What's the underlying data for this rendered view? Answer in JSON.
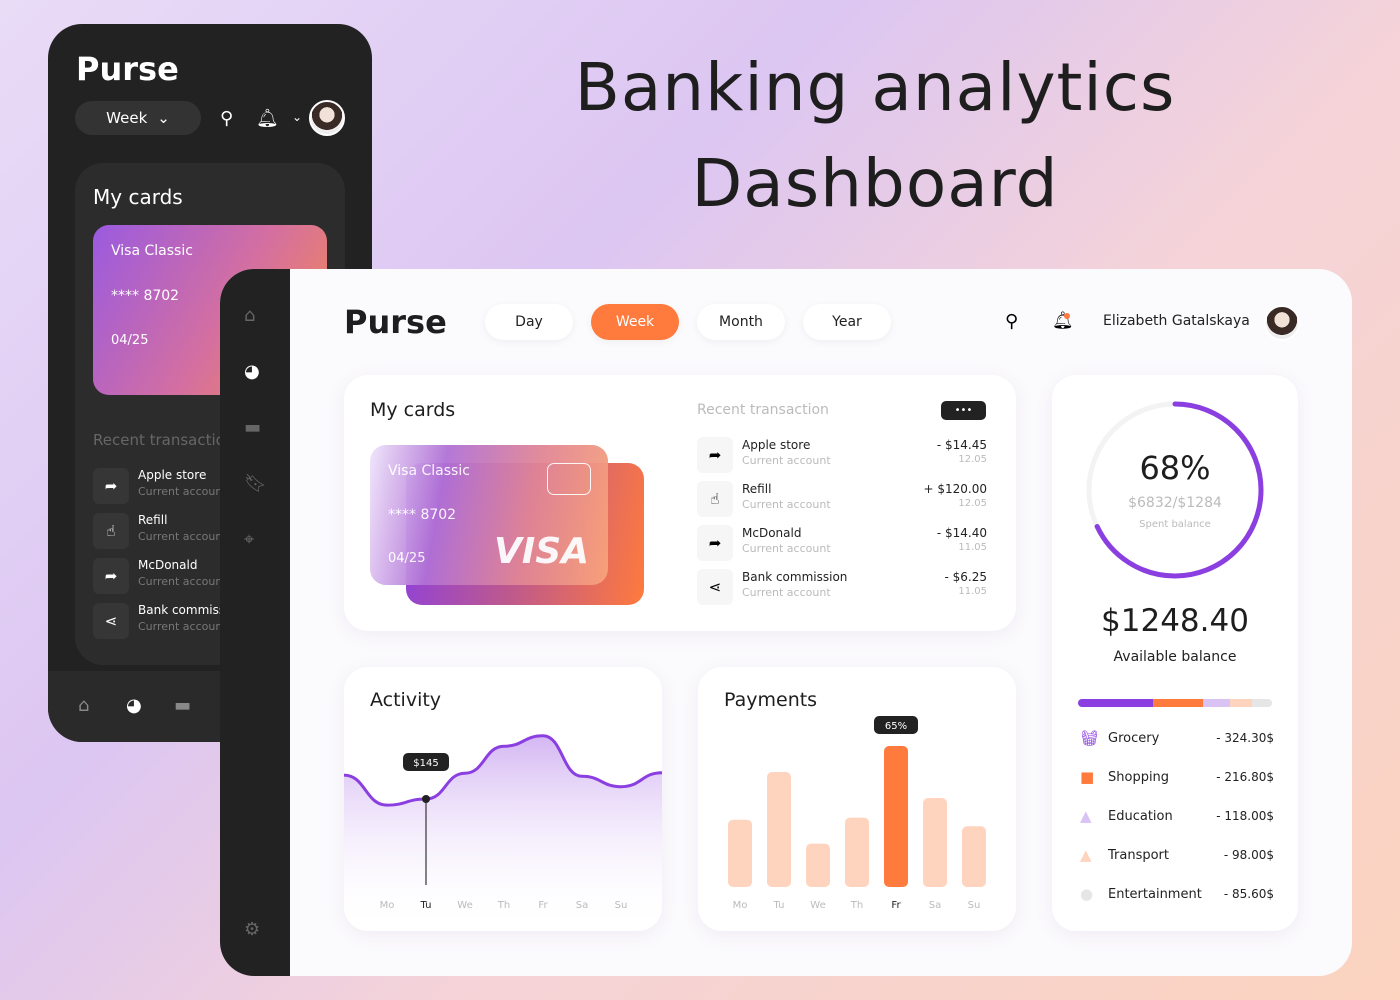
{
  "headline": [
    "Banking analytics",
    "Dashboard"
  ],
  "app_name": "Purse",
  "mobile": {
    "period": "Week",
    "my_cards": "My cards",
    "card": {
      "name": "Visa Classic",
      "number": "**** 8702",
      "expiry": "04/25"
    },
    "recent_title": "Recent transaction",
    "transactions": [
      {
        "name": "Apple store",
        "account": "Current account"
      },
      {
        "name": "Refill",
        "account": "Current account"
      },
      {
        "name": "McDonald",
        "account": "Current account"
      },
      {
        "name": "Bank commission",
        "account": "Current account"
      }
    ]
  },
  "header": {
    "tabs": [
      {
        "label": "Day"
      },
      {
        "label": "Week",
        "active": true
      },
      {
        "label": "Month"
      },
      {
        "label": "Year"
      }
    ],
    "user_name": "Elizabeth Gatalskaya"
  },
  "my_cards": {
    "title": "My cards",
    "card": {
      "name": "Visa Classic",
      "number": "**** 8702",
      "expiry": "04/25",
      "brand": "VISA"
    },
    "recent_title": "Recent transaction",
    "more_label": "•••",
    "transactions": [
      {
        "name": "Apple store",
        "account": "Current account",
        "amount": "- $14.45",
        "date": "12.05",
        "icon": "arrow-forward-icon"
      },
      {
        "name": "Refill",
        "account": "Current account",
        "amount": "+ $120.00",
        "date": "12.05",
        "icon": "hand-pointer-icon"
      },
      {
        "name": "McDonald",
        "account": "Current account",
        "amount": "- $14.40",
        "date": "11.05",
        "icon": "arrow-forward-icon"
      },
      {
        "name": "Bank commission",
        "account": "Current account",
        "amount": "- $6.25",
        "date": "11.05",
        "icon": "share-icon"
      }
    ]
  },
  "balance": {
    "percent": "68%",
    "percent_value": 68,
    "ratio": "$6832/$1284",
    "ratio_label": "Spent balance",
    "amount": "$1248.40",
    "amount_label": "Available balance",
    "categories": [
      {
        "name": "Grocery",
        "value": "- 324.30$",
        "color": "#8b3fe0",
        "icon": "basket-icon"
      },
      {
        "name": "Shopping",
        "value": "- 216.80$",
        "color": "#ff7a3d",
        "icon": "bag-icon"
      },
      {
        "name": "Education",
        "value": "- 118.00$",
        "color": "#d9c2f4",
        "icon": "graduation-cap-icon"
      },
      {
        "name": "Transport",
        "value": "- 98.00$",
        "color": "#ffd4bf",
        "icon": "navigation-icon"
      },
      {
        "name": "Entertainment",
        "value": "- 85.60$",
        "color": "#e6e6e6",
        "icon": "flame-icon"
      }
    ]
  },
  "chart_data": [
    {
      "type": "area",
      "title": "Activity",
      "categories": [
        "Mo",
        "Tu",
        "We",
        "Th",
        "Fr",
        "Sa",
        "Su"
      ],
      "values": [
        135,
        145,
        187,
        231,
        248,
        182,
        165
      ],
      "highlight": {
        "category": "Tu",
        "label": "$145"
      },
      "color": "#8b3fe0"
    },
    {
      "type": "bar",
      "title": "Payments",
      "categories": [
        "Mo",
        "Tu",
        "We",
        "Th",
        "Fr",
        "Sa",
        "Su"
      ],
      "values": [
        31,
        53,
        20,
        32,
        65,
        41,
        28
      ],
      "highlight": {
        "category": "Fr",
        "label": "65%"
      },
      "color": "#ffd4bf",
      "highlight_color": "#ff7a3d"
    }
  ]
}
